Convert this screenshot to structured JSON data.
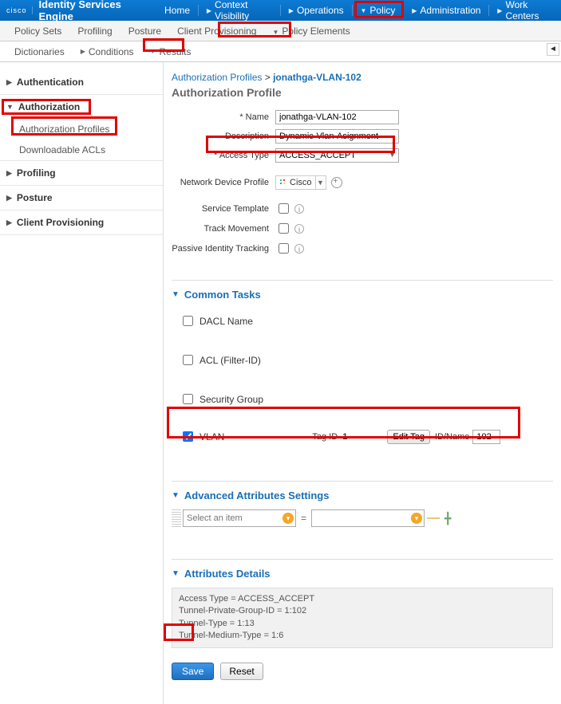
{
  "brand": {
    "cisco": "cisco",
    "name": "Identity Services Engine"
  },
  "topnav": {
    "home": "Home",
    "context": "Context Visibility",
    "operations": "Operations",
    "policy": "Policy",
    "admin": "Administration",
    "workcenters": "Work Centers"
  },
  "subnav": {
    "policysets": "Policy Sets",
    "profiling": "Profiling",
    "posture": "Posture",
    "clientprov": "Client Provisioning",
    "policyelements": "Policy Elements"
  },
  "crumbnav": {
    "dictionaries": "Dictionaries",
    "conditions": "Conditions",
    "results": "Results"
  },
  "sidebar": {
    "authentication": "Authentication",
    "authorization": "Authorization",
    "authprofiles": "Authorization Profiles",
    "dlacls": "Downloadable ACLs",
    "profiling": "Profiling",
    "posture": "Posture",
    "clientprov": "Client Provisioning"
  },
  "breadcrumb": {
    "parent": "Authorization Profiles",
    "sep": ">",
    "current": "jonathga-VLAN-102"
  },
  "page_title": "Authorization Profile",
  "form": {
    "name_label": "* Name",
    "name_value": "jonathga-VLAN-102",
    "desc_label": "Description",
    "desc_value": "Dynamic-Vlan-Asignment",
    "access_label": "* Access Type",
    "access_value": "ACCESS_ACCEPT",
    "ndp_label": "Network Device Profile",
    "ndp_value": "Cisco",
    "svctmpl_label": "Service Template",
    "trackmove_label": "Track Movement",
    "passive_label": "Passive Identity Tracking"
  },
  "common_tasks": {
    "title": "Common Tasks",
    "dacl": "DACL Name",
    "acl": "ACL (Filter-ID)",
    "secgroup": "Security Group",
    "vlan": "VLAN",
    "tagid_label": "Tag ID",
    "tagid_value": "1",
    "edittag": "Edit Tag",
    "idname_label": "ID/Name",
    "idname_value": "102"
  },
  "advanced": {
    "title": "Advanced Attributes Settings",
    "placeholder": "Select an item"
  },
  "attrs_details": {
    "title": "Attributes Details",
    "body": "Access Type = ACCESS_ACCEPT\nTunnel-Private-Group-ID = 1:102\nTunnel-Type = 1:13\nTunnel-Medium-Type = 1:6"
  },
  "buttons": {
    "save": "Save",
    "reset": "Reset"
  }
}
